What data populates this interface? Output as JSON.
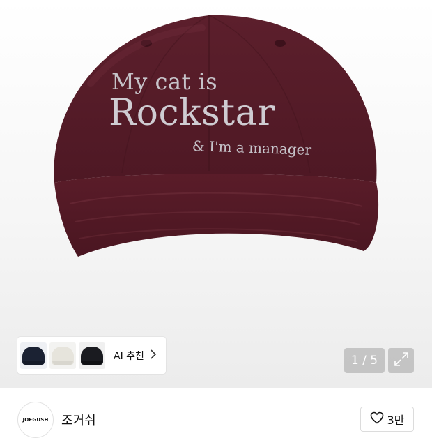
{
  "product": {
    "image_text": {
      "line1": "My cat is",
      "line2": "Rockstar",
      "line3": "& I'm a manager"
    }
  },
  "recommend": {
    "label": "AI 추천",
    "thumbnails": [
      {
        "color": "#1b2233"
      },
      {
        "color": "#e6e4dc"
      },
      {
        "color": "#1a1b20"
      }
    ]
  },
  "gallery": {
    "counter": "1 / 5"
  },
  "store": {
    "name": "조거쉬",
    "logo_text": "JOEGUSH",
    "like_count": "3만"
  },
  "colors": {
    "cap": "#5a1e2b",
    "stitch": "#c9c6cc"
  }
}
